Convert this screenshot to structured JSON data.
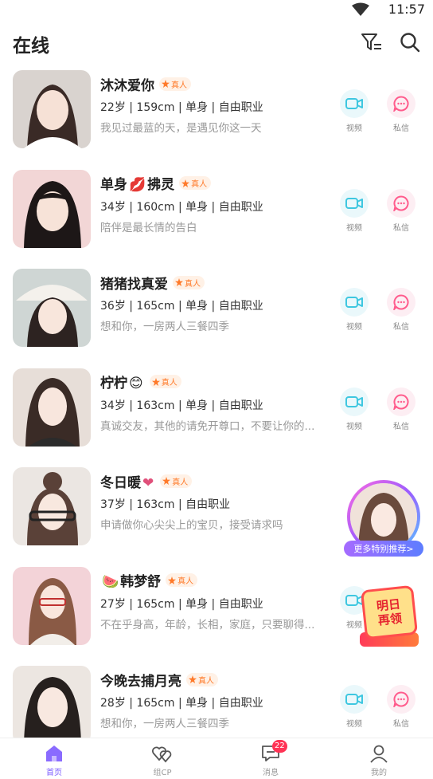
{
  "status_bar": {
    "time": "11:57"
  },
  "header": {
    "title": "在线"
  },
  "real_badge_text": "真人",
  "actions": {
    "video_label": "视频",
    "message_label": "私信"
  },
  "users": [
    {
      "name": "沐沐爱你",
      "emoji": "",
      "info": "22岁 | 159cm | 单身 | 自由职业",
      "desc": "我见过最蓝的天，是遇见你这一天"
    },
    {
      "name_prefix": "单身",
      "emoji": "💋",
      "name": "拂灵",
      "info": "34岁 | 160cm | 单身 | 自由职业",
      "desc": "陪伴是最长情的告白"
    },
    {
      "name": "猪猪找真爱",
      "emoji": "",
      "info": "36岁 | 165cm | 单身 | 自由职业",
      "desc": "想和你，一房两人三餐四季"
    },
    {
      "name": "柠柠",
      "emoji": "😊",
      "info": "34岁 | 163cm | 单身 | 自由职业",
      "desc": "真诚交友，其他的请免开尊口，不要让你的..."
    },
    {
      "name": "冬日暖",
      "emoji": "❤",
      "info": "37岁 | 163cm | 自由职业",
      "desc": "申请做你心尖尖上的宝贝，接受请求吗"
    },
    {
      "name": "韩梦舒",
      "emoji": "🍉",
      "info": "27岁 | 165cm | 单身 | 自由职业",
      "desc": "不在乎身高，年龄，长相，家庭，只要聊得..."
    },
    {
      "name": "今晚去捕月亮",
      "emoji": "",
      "info": "28岁 | 165cm | 单身 | 自由职业",
      "desc": "想和你，一房两人三餐四季"
    }
  ],
  "floating": {
    "recommend_label": "更多特别推荐>",
    "coupon_line1": "明日",
    "coupon_line2": "再领"
  },
  "tabbar": {
    "tabs": [
      {
        "label": "首页",
        "icon": "home-icon"
      },
      {
        "label": "组CP",
        "icon": "hearts-icon"
      },
      {
        "label": "消息",
        "icon": "chat-icon",
        "badge": "22"
      },
      {
        "label": "我的",
        "icon": "person-icon"
      }
    ]
  },
  "colors": {
    "accent": "#7c5cff",
    "video": "#3ec7e0",
    "message": "#ff5b8c",
    "badge": "#ff7a2a"
  }
}
